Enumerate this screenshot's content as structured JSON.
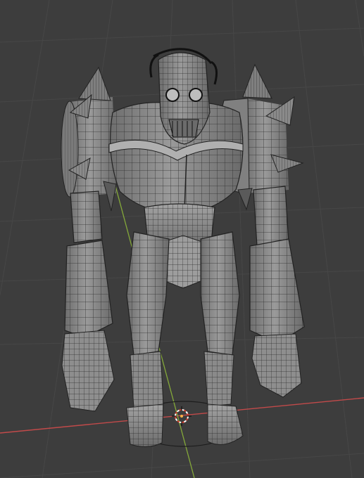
{
  "viewport": {
    "background": "#3d3d3d",
    "grid_color": "#474747",
    "x_axis_color": "#c24a4a",
    "y_axis_color": "#84a83a",
    "mesh_color": "#8d8d8d",
    "mesh_light": "#a8a8a8",
    "mesh_dark": "#5e5e5e",
    "wire_color": "#2a2a2a",
    "cursor_colors": [
      "#d23c2c",
      "#ffffff"
    ]
  },
  "scene": {
    "object": "character-mesh",
    "shading": "solid",
    "overlay": "wireframe",
    "icons": [
      "3d-cursor-icon"
    ]
  }
}
